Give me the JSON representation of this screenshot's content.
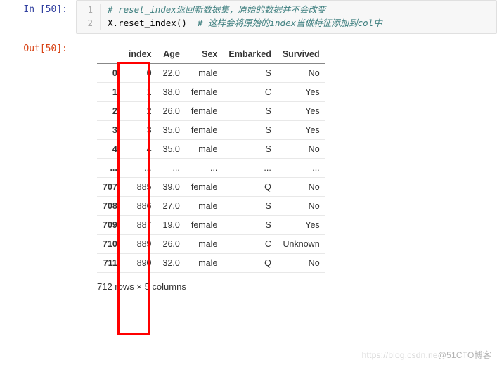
{
  "in_prompt": "In [50]:",
  "out_prompt": "Out[50]:",
  "code": {
    "line_nums": [
      "1",
      "2"
    ],
    "line1_comment": "# reset_index返回新数据集，原始的数据并不会改变",
    "line2_code": "X.reset_index()  ",
    "line2_comment": "# 这样会将原始的index当做特征添加到col中"
  },
  "columns": [
    "index",
    "Age",
    "Sex",
    "Embarked",
    "Survived"
  ],
  "rows": [
    {
      "idx": "0",
      "index": "0",
      "Age": "22.0",
      "Sex": "male",
      "Embarked": "S",
      "Survived": "No"
    },
    {
      "idx": "1",
      "index": "1",
      "Age": "38.0",
      "Sex": "female",
      "Embarked": "C",
      "Survived": "Yes"
    },
    {
      "idx": "2",
      "index": "2",
      "Age": "26.0",
      "Sex": "female",
      "Embarked": "S",
      "Survived": "Yes"
    },
    {
      "idx": "3",
      "index": "3",
      "Age": "35.0",
      "Sex": "female",
      "Embarked": "S",
      "Survived": "Yes"
    },
    {
      "idx": "4",
      "index": "4",
      "Age": "35.0",
      "Sex": "male",
      "Embarked": "S",
      "Survived": "No"
    },
    {
      "idx": "...",
      "index": "...",
      "Age": "...",
      "Sex": "...",
      "Embarked": "...",
      "Survived": "..."
    },
    {
      "idx": "707",
      "index": "885",
      "Age": "39.0",
      "Sex": "female",
      "Embarked": "Q",
      "Survived": "No"
    },
    {
      "idx": "708",
      "index": "886",
      "Age": "27.0",
      "Sex": "male",
      "Embarked": "S",
      "Survived": "No"
    },
    {
      "idx": "709",
      "index": "887",
      "Age": "19.0",
      "Sex": "female",
      "Embarked": "S",
      "Survived": "Yes"
    },
    {
      "idx": "710",
      "index": "889",
      "Age": "26.0",
      "Sex": "male",
      "Embarked": "C",
      "Survived": "Unknown"
    },
    {
      "idx": "711",
      "index": "890",
      "Age": "32.0",
      "Sex": "male",
      "Embarked": "Q",
      "Survived": "No"
    }
  ],
  "footer": "712 rows × 5 columns",
  "watermark_faint": "https://blog.csdn.ne",
  "watermark": "@51CTO博客"
}
